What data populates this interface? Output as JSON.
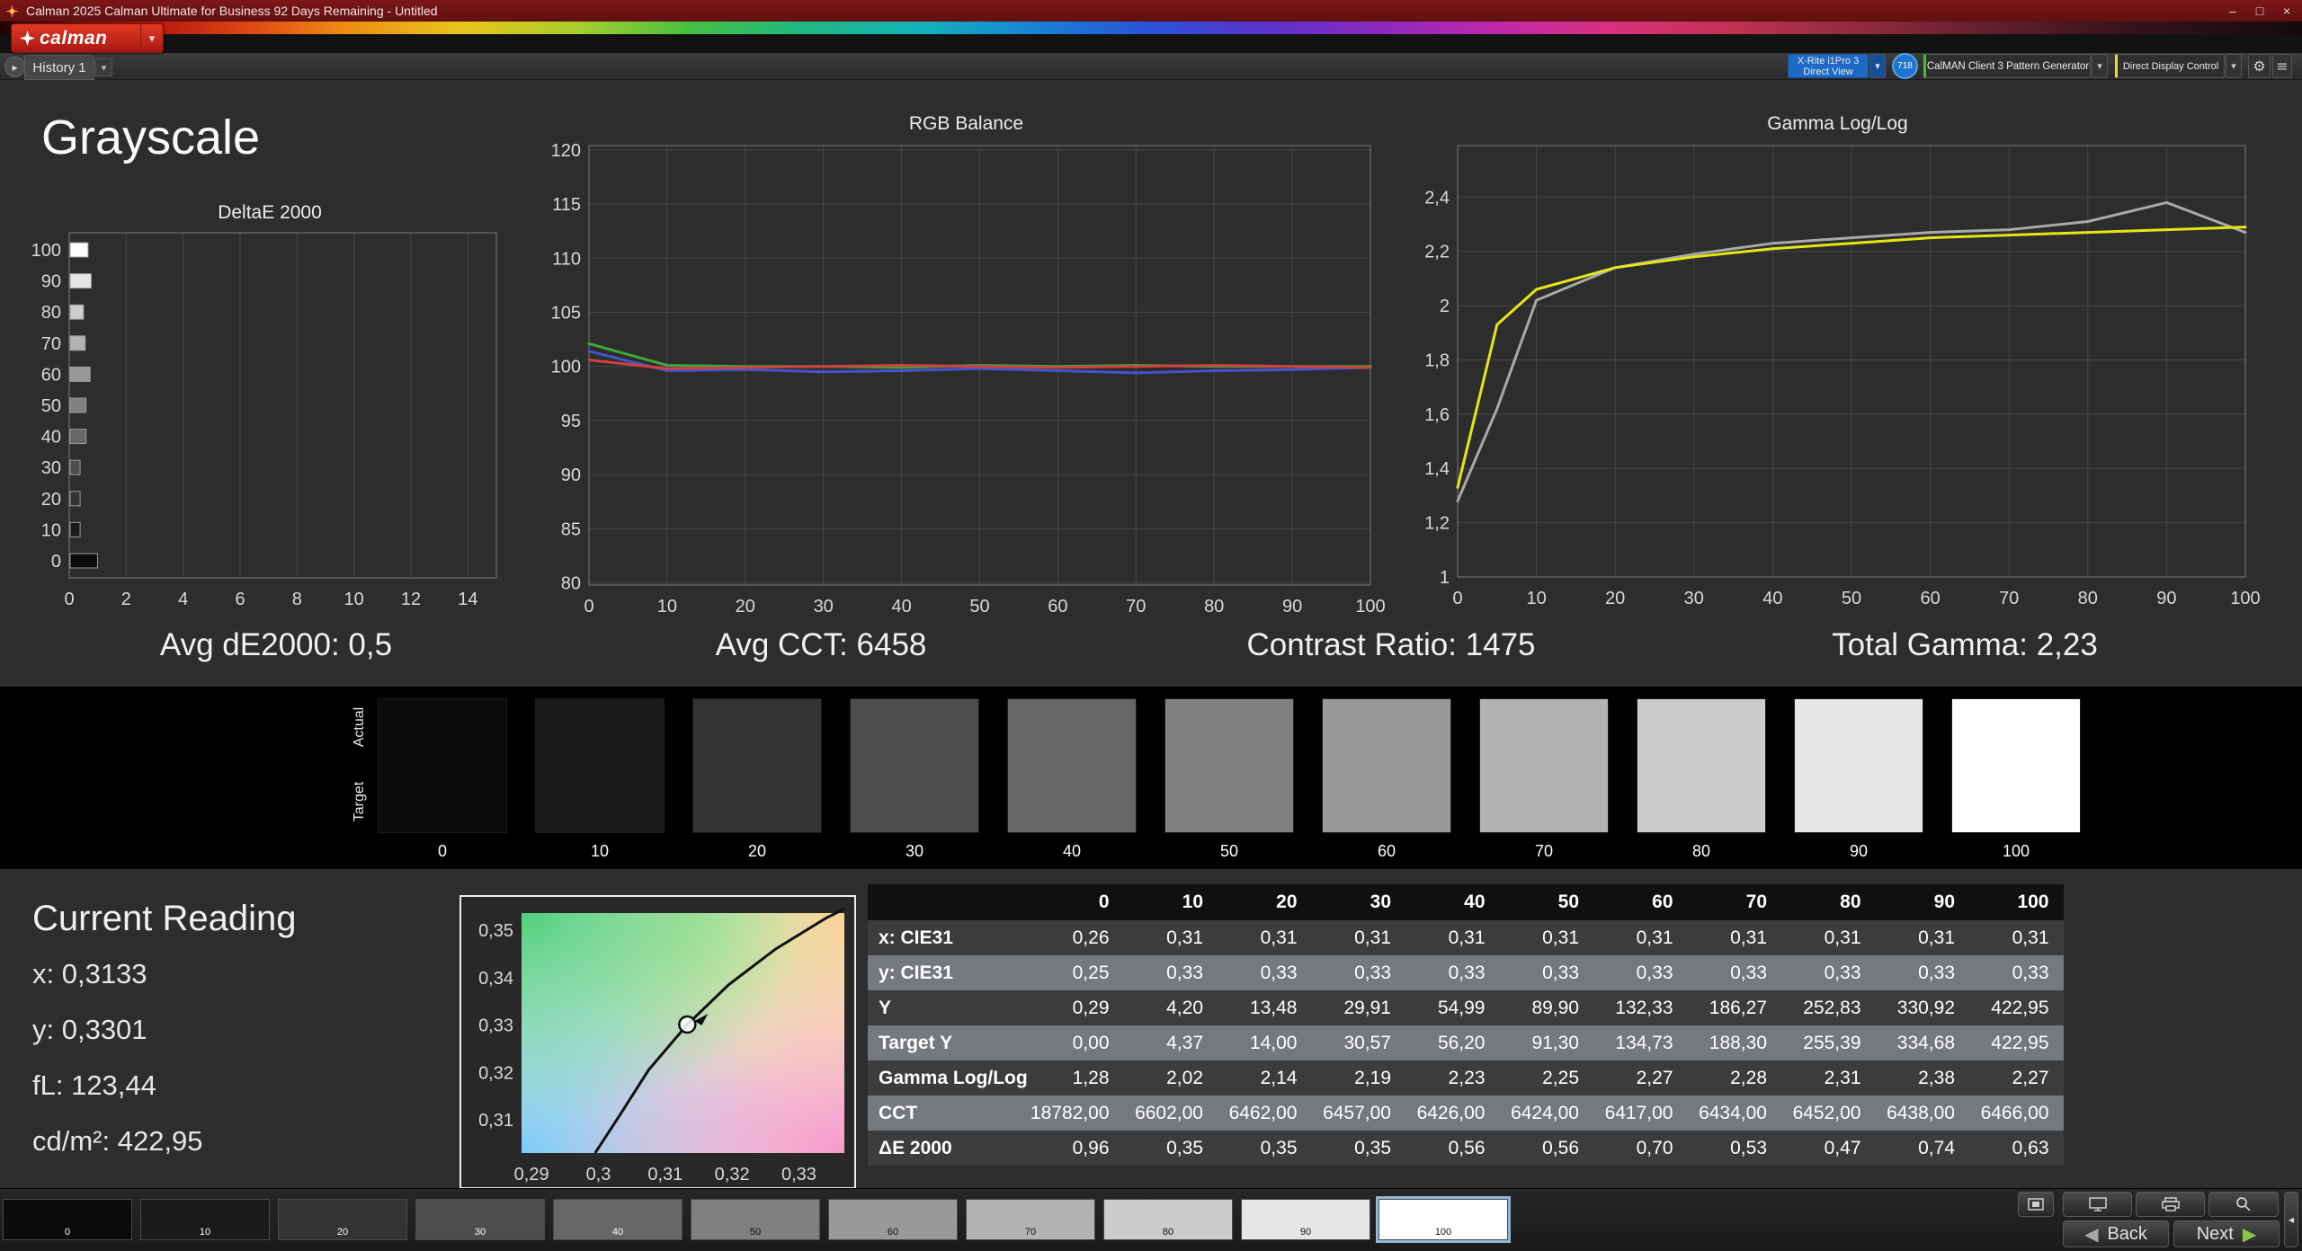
{
  "window": {
    "title": "Calman 2025 Calman Ultimate for Business 92 Days Remaining - Untitled",
    "controls": {
      "minimize": "–",
      "maximize": "□",
      "close": "×"
    }
  },
  "brand": {
    "logo_text": "calman"
  },
  "glyphs": {
    "dropdown": "▾",
    "tab_nav": "▸",
    "back": "◀",
    "next": "▶",
    "drawer": "◂",
    "gear": "⚙",
    "menu": "≡"
  },
  "tabbar": {
    "tab": "History 1"
  },
  "devices": {
    "meter": {
      "line1": "X-Rite i1Pro 3",
      "line2": "Direct View",
      "badge": "718",
      "color": "#1d69c4",
      "dd_color": "#164f97"
    },
    "pattern_generator": {
      "label": "CalMAN Client 3 Pattern Generator",
      "accent": "#3ec431"
    },
    "display_control": {
      "label": "Direct Display Control",
      "accent": "#e6df25"
    }
  },
  "page": {
    "heading": "Grayscale"
  },
  "stats": [
    "Avg dE2000: 0,5",
    "Avg CCT: 6458",
    "Contrast Ratio: 1475",
    "Total Gamma: 2,23"
  ],
  "gray_ramp": {
    "actual_label": "Actual",
    "target_label": "Target",
    "selected": "100",
    "levels": [
      {
        "label": "0",
        "color": "#0b0b0b"
      },
      {
        "label": "10",
        "color": "#1a1a1a"
      },
      {
        "label": "20",
        "color": "#333333"
      },
      {
        "label": "30",
        "color": "#4d4d4d"
      },
      {
        "label": "40",
        "color": "#666666"
      },
      {
        "label": "50",
        "color": "#808080"
      },
      {
        "label": "60",
        "color": "#999999"
      },
      {
        "label": "70",
        "color": "#b3b3b3"
      },
      {
        "label": "80",
        "color": "#cccccc"
      },
      {
        "label": "90",
        "color": "#e6e6e6"
      },
      {
        "label": "100",
        "color": "#ffffff"
      }
    ]
  },
  "current_reading": {
    "heading": "Current Reading",
    "lines": [
      "x: 0,3133",
      "y: 0,3301",
      "fL: 123,44",
      "cd/m²: 422,95"
    ]
  },
  "table": {
    "columns": [
      "0",
      "10",
      "20",
      "30",
      "40",
      "50",
      "60",
      "70",
      "80",
      "90",
      "100"
    ],
    "rows": [
      {
        "label": "x: CIE31",
        "values": [
          "0,26",
          "0,31",
          "0,31",
          "0,31",
          "0,31",
          "0,31",
          "0,31",
          "0,31",
          "0,31",
          "0,31",
          "0,31"
        ]
      },
      {
        "label": "y: CIE31",
        "values": [
          "0,25",
          "0,33",
          "0,33",
          "0,33",
          "0,33",
          "0,33",
          "0,33",
          "0,33",
          "0,33",
          "0,33",
          "0,33"
        ]
      },
      {
        "label": "Y",
        "values": [
          "0,29",
          "4,20",
          "13,48",
          "29,91",
          "54,99",
          "89,90",
          "132,33",
          "186,27",
          "252,83",
          "330,92",
          "422,95"
        ]
      },
      {
        "label": "Target Y",
        "values": [
          "0,00",
          "4,37",
          "14,00",
          "30,57",
          "56,20",
          "91,30",
          "134,73",
          "188,30",
          "255,39",
          "334,68",
          "422,95"
        ]
      },
      {
        "label": "Gamma Log/Log",
        "values": [
          "1,28",
          "2,02",
          "2,14",
          "2,19",
          "2,23",
          "2,25",
          "2,27",
          "2,28",
          "2,31",
          "2,38",
          "2,27"
        ]
      },
      {
        "label": "CCT",
        "values": [
          "18782,00",
          "6602,00",
          "6462,00",
          "6457,00",
          "6426,00",
          "6424,00",
          "6417,00",
          "6434,00",
          "6452,00",
          "6438,00",
          "6466,00"
        ]
      },
      {
        "label": "ΔE 2000",
        "values": [
          "0,96",
          "0,35",
          "0,35",
          "0,35",
          "0,56",
          "0,56",
          "0,70",
          "0,53",
          "0,47",
          "0,74",
          "0,63"
        ]
      }
    ]
  },
  "nav": {
    "back": "Back",
    "next": "Next"
  },
  "chart_data": [
    {
      "id": "deltae",
      "type": "bar",
      "orientation": "horizontal",
      "title": "DeltaE 2000",
      "categories": [
        0,
        10,
        20,
        30,
        40,
        50,
        60,
        70,
        80,
        90,
        100
      ],
      "values": [
        0.96,
        0.35,
        0.35,
        0.35,
        0.56,
        0.56,
        0.7,
        0.53,
        0.47,
        0.74,
        0.63
      ],
      "bar_colors": [
        "#0b0b0b",
        "#1a1a1a",
        "#333333",
        "#4d4d4d",
        "#666666",
        "#808080",
        "#999999",
        "#b3b3b3",
        "#cccccc",
        "#e6e6e6",
        "#ffffff"
      ],
      "xlim": [
        0,
        15
      ],
      "ylim": [
        -5.5,
        105.5
      ],
      "grid": "x",
      "xticks": [
        {
          "v": 0,
          "label": "0"
        },
        {
          "v": 2,
          "label": "2"
        },
        {
          "v": 4,
          "label": "4"
        },
        {
          "v": 6,
          "label": "6"
        },
        {
          "v": 8,
          "label": "8"
        },
        {
          "v": 10,
          "label": "10"
        },
        {
          "v": 12,
          "label": "12"
        },
        {
          "v": 14,
          "label": "14"
        }
      ],
      "yticks": [
        {
          "v": 100,
          "label": "100"
        },
        {
          "v": 90,
          "label": "90"
        },
        {
          "v": 80,
          "label": "80"
        },
        {
          "v": 70,
          "label": "70"
        },
        {
          "v": 60,
          "label": "60"
        },
        {
          "v": 50,
          "label": "50"
        },
        {
          "v": 40,
          "label": "40"
        },
        {
          "v": 30,
          "label": "30"
        },
        {
          "v": 20,
          "label": "20"
        },
        {
          "v": 10,
          "label": "10"
        },
        {
          "v": 0,
          "label": "0"
        }
      ]
    },
    {
      "id": "rgb",
      "type": "line",
      "title": "RGB Balance",
      "x": [
        0,
        10,
        20,
        30,
        40,
        50,
        60,
        70,
        80,
        90,
        100
      ],
      "series": [
        {
          "name": "Blue",
          "color": "#4553cc",
          "values": [
            101.4,
            99.6,
            99.7,
            99.5,
            99.6,
            99.8,
            99.6,
            99.4,
            99.6,
            99.7,
            99.9
          ]
        },
        {
          "name": "Green",
          "color": "#3aa83a",
          "values": [
            102.1,
            100.1,
            100.0,
            100.0,
            99.9,
            100.1,
            100.0,
            100.1,
            100.0,
            100.0,
            100.0
          ]
        },
        {
          "name": "Red",
          "color": "#cf4040",
          "values": [
            100.6,
            99.8,
            99.9,
            100.0,
            100.1,
            100.0,
            99.9,
            100.0,
            100.1,
            100.0,
            99.9
          ]
        }
      ],
      "xlim": [
        0,
        100
      ],
      "ylim": [
        79.8,
        120.4
      ],
      "grid": "xy",
      "xticks": [
        {
          "v": 0,
          "label": "0"
        },
        {
          "v": 10,
          "label": "10"
        },
        {
          "v": 20,
          "label": "20"
        },
        {
          "v": 30,
          "label": "30"
        },
        {
          "v": 40,
          "label": "40"
        },
        {
          "v": 50,
          "label": "50"
        },
        {
          "v": 60,
          "label": "60"
        },
        {
          "v": 70,
          "label": "70"
        },
        {
          "v": 80,
          "label": "80"
        },
        {
          "v": 90,
          "label": "90"
        },
        {
          "v": 100,
          "label": "100"
        }
      ],
      "yticks": [
        {
          "v": 120,
          "label": "120"
        },
        {
          "v": 115,
          "label": "115"
        },
        {
          "v": 110,
          "label": "110"
        },
        {
          "v": 105,
          "label": "105"
        },
        {
          "v": 100,
          "label": "100"
        },
        {
          "v": 95,
          "label": "95"
        },
        {
          "v": 90,
          "label": "90"
        },
        {
          "v": 85,
          "label": "85"
        },
        {
          "v": 80,
          "label": "80"
        }
      ]
    },
    {
      "id": "gamma",
      "type": "line",
      "title": "Gamma Log/Log",
      "x": [
        0,
        5,
        10,
        20,
        30,
        40,
        50,
        60,
        70,
        80,
        90,
        100
      ],
      "series": [
        {
          "name": "Measured",
          "color": "#a9a9a9",
          "values": [
            1.28,
            1.62,
            2.02,
            2.14,
            2.19,
            2.23,
            2.25,
            2.27,
            2.28,
            2.31,
            2.38,
            2.27
          ]
        },
        {
          "name": "Target",
          "color": "#e8e516",
          "values": [
            1.33,
            1.93,
            2.06,
            2.14,
            2.18,
            2.21,
            2.23,
            2.25,
            2.26,
            2.27,
            2.28,
            2.29
          ]
        }
      ],
      "xlim": [
        0,
        100
      ],
      "ylim": [
        1.0,
        2.59
      ],
      "grid": "xy",
      "xticks": [
        {
          "v": 0,
          "label": "0"
        },
        {
          "v": 10,
          "label": "10"
        },
        {
          "v": 20,
          "label": "20"
        },
        {
          "v": 30,
          "label": "30"
        },
        {
          "v": 40,
          "label": "40"
        },
        {
          "v": 50,
          "label": "50"
        },
        {
          "v": 60,
          "label": "60"
        },
        {
          "v": 70,
          "label": "70"
        },
        {
          "v": 80,
          "label": "80"
        },
        {
          "v": 90,
          "label": "90"
        },
        {
          "v": 100,
          "label": "100"
        }
      ],
      "yticks": [
        {
          "v": 2.4,
          "label": "2,4"
        },
        {
          "v": 2.2,
          "label": "2,2"
        },
        {
          "v": 2.0,
          "label": "2"
        },
        {
          "v": 1.8,
          "label": "1,8"
        },
        {
          "v": 1.6,
          "label": "1,6"
        },
        {
          "v": 1.4,
          "label": "1,4"
        },
        {
          "v": 1.2,
          "label": "1,2"
        },
        {
          "v": 1.0,
          "label": "1"
        }
      ]
    },
    {
      "id": "cie",
      "type": "scatter",
      "title": "CIE Chromaticity",
      "xlim": [
        0.2885,
        0.3368
      ],
      "ylim": [
        0.303,
        0.3536
      ],
      "grid": "",
      "border": false,
      "xticks": [
        {
          "v": 0.29,
          "label": "0,29"
        },
        {
          "v": 0.3,
          "label": "0,3"
        },
        {
          "v": 0.31,
          "label": "0,31"
        },
        {
          "v": 0.32,
          "label": "0,32"
        },
        {
          "v": 0.33,
          "label": "0,33"
        }
      ],
      "yticks": [
        {
          "v": 0.35,
          "label": "0,35"
        },
        {
          "v": 0.34,
          "label": "0,34"
        },
        {
          "v": 0.33,
          "label": "0,33"
        },
        {
          "v": 0.32,
          "label": "0,32"
        },
        {
          "v": 0.31,
          "label": "0,31"
        }
      ],
      "locus": [
        [
          0.2995,
          0.303
        ],
        [
          0.3032,
          0.311
        ],
        [
          0.3075,
          0.3205
        ],
        [
          0.3133,
          0.3301
        ],
        [
          0.3195,
          0.3385
        ],
        [
          0.3265,
          0.346
        ],
        [
          0.334,
          0.3525
        ],
        [
          0.3368,
          0.3545
        ]
      ],
      "marker": {
        "x": 0.3133,
        "y": 0.3301
      }
    }
  ]
}
